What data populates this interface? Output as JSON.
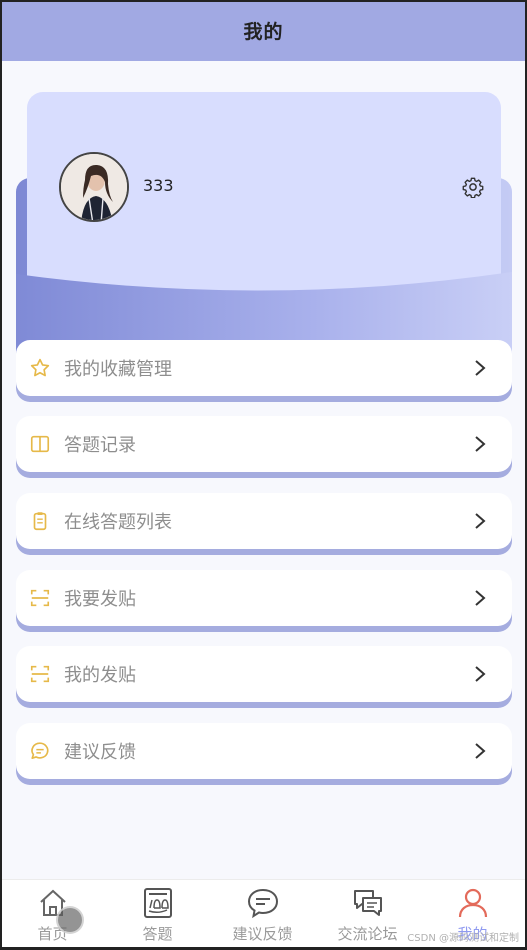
{
  "header": {
    "title": "我的"
  },
  "profile": {
    "username": "333",
    "avatar_icon": "user-avatar-photo",
    "settings_icon": "gear-icon"
  },
  "menu": [
    {
      "label": "我的收藏管理",
      "icon": "star-icon"
    },
    {
      "label": "答题记录",
      "icon": "book-icon"
    },
    {
      "label": "在线答题列表",
      "icon": "clipboard-icon"
    },
    {
      "label": "我要发贴",
      "icon": "scan-icon"
    },
    {
      "label": "我的发贴",
      "icon": "scan-icon"
    },
    {
      "label": "建议反馈",
      "icon": "chat-icon"
    }
  ],
  "tabbar": [
    {
      "label": "首页",
      "icon": "home-icon"
    },
    {
      "label": "答题",
      "icon": "exam-icon"
    },
    {
      "label": "建议反馈",
      "icon": "chat-bubble-icon"
    },
    {
      "label": "交流论坛",
      "icon": "forum-icon"
    },
    {
      "label": "我的",
      "icon": "user-icon",
      "active": true
    }
  ],
  "colors": {
    "header": "#a1a9e3",
    "card": "#d8ddfe",
    "accent_shadow": "#a5acdf",
    "icon_yellow": "#e6b949",
    "active_tab": "#8f9af0",
    "active_tab_icon": "#e36a5a"
  },
  "watermark": "CSDN @源码测试和定制"
}
